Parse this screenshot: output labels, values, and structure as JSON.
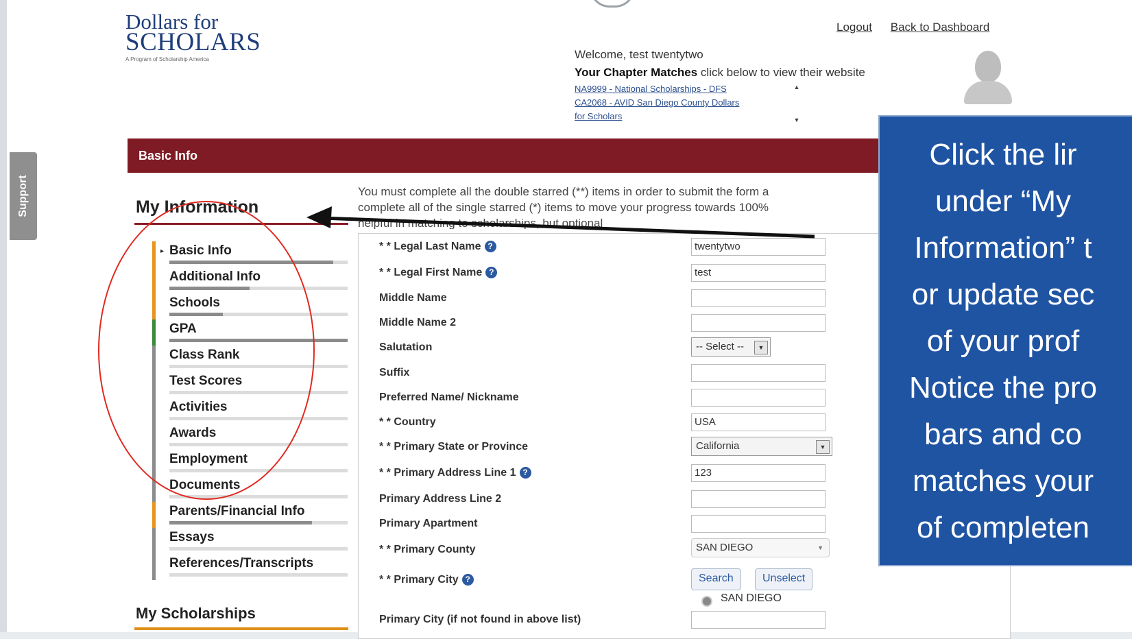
{
  "header": {
    "logo_line1": "Dollars for",
    "logo_line2": "SCHOLARS",
    "logo_tagline": "A Program of Scholarship America",
    "logout": "Logout",
    "back": "Back to Dashboard",
    "welcome": "Welcome, test twentytwo",
    "chapter_bold": "Your Chapter Matches",
    "chapter_rest": " click below to view their website",
    "chapters": [
      "NA9999 - National Scholarships - DFS",
      "CA2068 - AVID San Diego County Dollars",
      "for Scholars"
    ]
  },
  "support_label": "Support",
  "section_bar": "Basic Info",
  "sidebar": {
    "heading": "My Information",
    "items": [
      {
        "label": "Basic Info",
        "progress": 0.92,
        "side": "#e8951f",
        "current": true
      },
      {
        "label": "Additional Info",
        "progress": 0.45,
        "side": "#e8951f"
      },
      {
        "label": "Schools",
        "progress": 0.3,
        "side": "#e8951f"
      },
      {
        "label": "GPA",
        "progress": 1.0,
        "side": "#3c8a3c"
      },
      {
        "label": "Class Rank",
        "progress": 0.0,
        "side": "#8c8c8c"
      },
      {
        "label": "Test Scores",
        "progress": 0.0,
        "side": "#8c8c8c"
      },
      {
        "label": "Activities",
        "progress": 0.0,
        "side": "#8c8c8c"
      },
      {
        "label": "Awards",
        "progress": 0.0,
        "side": "#8c8c8c"
      },
      {
        "label": "Employment",
        "progress": 0.0,
        "side": "#8c8c8c"
      },
      {
        "label": "Documents",
        "progress": 0.0,
        "side": "#8c8c8c"
      },
      {
        "label": "Parents/Financial Info",
        "progress": 0.8,
        "side": "#e8951f"
      },
      {
        "label": "Essays",
        "progress": 0.0,
        "side": "#8c8c8c"
      },
      {
        "label": "References/Transcripts",
        "progress": 0.0,
        "side": "#8c8c8c"
      }
    ],
    "scholarships_heading": "My Scholarships"
  },
  "instructions": {
    "line1": "You must complete all the double starred (**) items in order to submit the form a",
    "line2": "complete all of the single starred (*) items to move your progress towards 100%",
    "line3": "helpful in matching to scholarships, but optional"
  },
  "form": {
    "legal_last": {
      "label": "* * Legal Last Name",
      "value": "twentytwo"
    },
    "legal_first": {
      "label": "* * Legal First Name",
      "value": "test"
    },
    "middle": {
      "label": "Middle Name",
      "value": ""
    },
    "middle2": {
      "label": "Middle Name 2",
      "value": ""
    },
    "salutation": {
      "label": "Salutation",
      "value": "-- Select --"
    },
    "suffix": {
      "label": "Suffix",
      "value": ""
    },
    "nickname": {
      "label": "Preferred Name/ Nickname",
      "value": ""
    },
    "country": {
      "label": "* * Country",
      "value": "USA"
    },
    "state": {
      "label": "* * Primary State or Province",
      "value": "California"
    },
    "addr1": {
      "label": "* * Primary Address Line 1",
      "value": "123"
    },
    "addr2": {
      "label": "Primary Address Line 2",
      "value": ""
    },
    "apt": {
      "label": "Primary Apartment",
      "value": ""
    },
    "county": {
      "label": "* * Primary County",
      "value": "SAN DIEGO"
    },
    "city": {
      "label": "* * Primary City",
      "search": "Search",
      "unselect": "Unselect",
      "option": "SAN DIEGO"
    },
    "city_other": {
      "label": "Primary City (if not found in above list)",
      "value": ""
    }
  },
  "callout": "Click the lir\nunder “My\nInformation” t\nor update sec\nof your prof\nNotice the pro\nbars and co\nmatches your\nof completen",
  "colors": {
    "brand_red": "#7f1b24",
    "callout_blue": "#1f54a3",
    "annotation_red": "#e0291f",
    "link_blue": "#2c5aa0"
  }
}
